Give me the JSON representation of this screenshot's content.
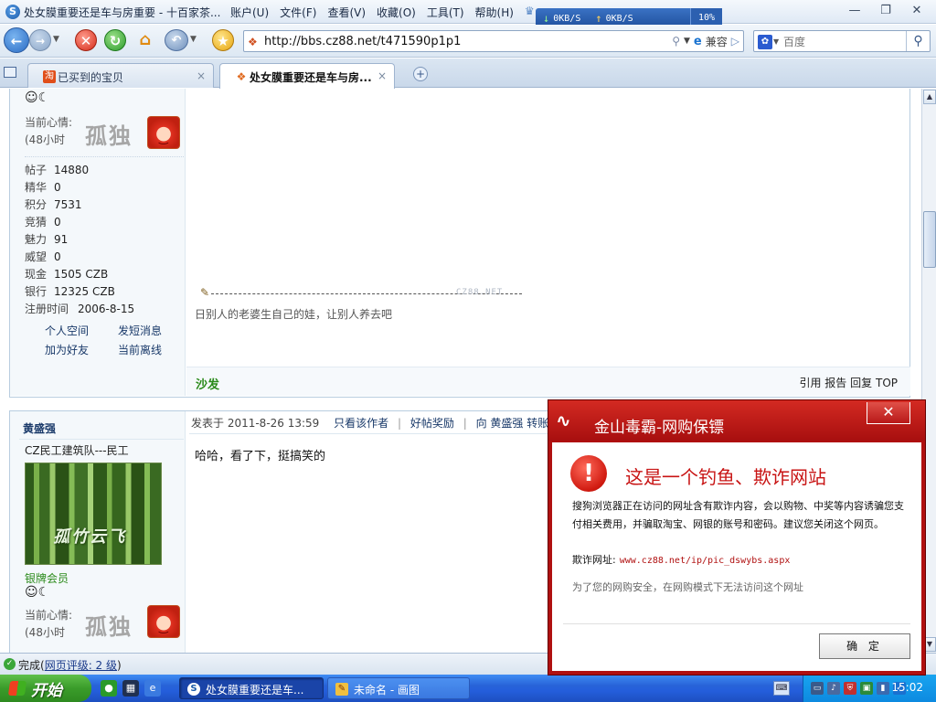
{
  "window": {
    "title": "处女膜重要还是车与房重要 - 十百家茶...",
    "menu": [
      "账户(U)",
      "文件(F)",
      "查看(V)",
      "收藏(O)",
      "工具(T)",
      "帮助(H)"
    ],
    "download_speed": "0KB/S",
    "upload_speed": "0KB/S",
    "cpu": "10%"
  },
  "toolbar": {
    "url": "http://bbs.cz88.net/t471590p1p1",
    "compat_label": "兼容",
    "search_placeholder": "百度"
  },
  "tabs": [
    {
      "label": "已买到的宝贝",
      "active": false
    },
    {
      "label": "处女膜重要还是车与房...",
      "active": true
    }
  ],
  "post1": {
    "mood_label_line1": "当前心情:",
    "mood_label_line2": "(48小时",
    "mood_text": "孤独",
    "stats": [
      {
        "k": "帖子",
        "v": "14880"
      },
      {
        "k": "精华",
        "v": "0"
      },
      {
        "k": "积分",
        "v": "7531"
      },
      {
        "k": "竞猜",
        "v": "0"
      },
      {
        "k": "魅力",
        "v": "91"
      },
      {
        "k": "威望",
        "v": "0"
      },
      {
        "k": "现金",
        "v": "1505 CZB"
      },
      {
        "k": "银行",
        "v": "12325 CZB"
      },
      {
        "k": "注册时间",
        "v": "2006-8-15"
      }
    ],
    "links": [
      "个人空间",
      "发短消息",
      "加为好友",
      "当前离线"
    ],
    "signature_watermark": "CZ88.NET",
    "signature": "日别人的老婆生自己的娃，让别人养去吧",
    "floor_label": "沙发",
    "actions": [
      "引用",
      "报告",
      "回复",
      "TOP"
    ]
  },
  "post2": {
    "username": "黄盛强",
    "user_title": "CZ民工建筑队---民工",
    "avatar_text": "孤竹云飞",
    "rank": "银牌会员",
    "mood_label_line1": "当前心情:",
    "mood_label_line2": "(48小时",
    "mood_text": "孤独",
    "posted_at": "发表于 2011-8-26 13:59",
    "only_author": "只看该作者",
    "reward": "好帖奖励",
    "transfer": "向 黄盛强 转账",
    "body": "哈哈，看了下，挺搞笑的"
  },
  "status": {
    "text": "完成",
    "rating_link": "网页评级: 2 级"
  },
  "taskbar": {
    "start_label": "开始",
    "tasks": [
      {
        "label": "处女膜重要还是车...",
        "active": true
      },
      {
        "label": "未命名 - 画图",
        "active": false
      }
    ],
    "clock": "15:02"
  },
  "popup": {
    "title": "金山毒霸-网购保镖",
    "headline": "这是一个钓鱼、欺诈网站",
    "description": "搜狗浏览器正在访问的网址含有欺诈内容，会以购物、中奖等内容诱骗您支付相关费用，并骗取淘宝、网银的账号和密码。建议您关闭这个网页。",
    "url_label": "欺诈网址:",
    "url": "www.cz88.net/ip/pic_dswybs.aspx",
    "note": "为了您的网购安全，在网购模式下无法访问这个网址",
    "ok_label": "确 定"
  }
}
